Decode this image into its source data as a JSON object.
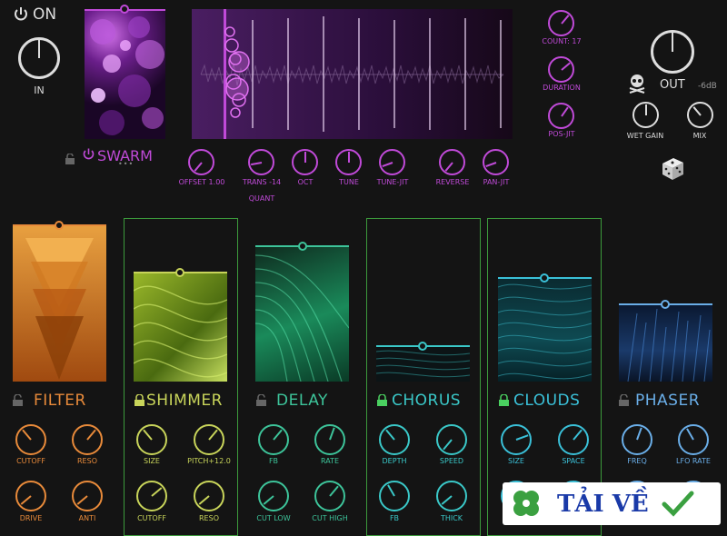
{
  "header": {
    "power_label": "ON",
    "in_label": "IN",
    "out_label": "OUT",
    "out_db": "-6dB",
    "wet_gain_label": "WET GAIN",
    "mix_label": "MIX"
  },
  "swarm": {
    "title": "SWARM",
    "dots": "•••"
  },
  "side_knobs": [
    "COUNT: 17",
    "DURATION",
    "POS-JIT"
  ],
  "bottom_knobs": [
    "OFFSET 1.00",
    "TRANS -14",
    "OCT",
    "TUNE",
    "TUNE-JIT",
    "REVERSE",
    "PAN-JIT"
  ],
  "quant_label": "QUANT",
  "modules": [
    {
      "name": "FILTER",
      "color": "#e88a3a",
      "locked": false,
      "knobs": [
        "CUTOFF",
        "RESO",
        "DRIVE",
        "ANTI"
      ]
    },
    {
      "name": "SHIMMER",
      "color": "#c8d45a",
      "locked": true,
      "knobs": [
        "SIZE",
        "PITCH+12.0",
        "CUTOFF",
        "RESO"
      ]
    },
    {
      "name": "DELAY",
      "color": "#3dc49a",
      "locked": false,
      "knobs": [
        "FB",
        "RATE",
        "CUT LOW",
        "CUT HIGH"
      ]
    },
    {
      "name": "CHORUS",
      "color": "#3ac8c8",
      "locked": true,
      "knobs": [
        "DEPTH",
        "SPEED",
        "FB",
        "THICK"
      ]
    },
    {
      "name": "CLOUDS",
      "color": "#3ac0d8",
      "locked": true,
      "knobs": [
        "SIZE",
        "SPACE",
        "",
        ""
      ]
    },
    {
      "name": "PHASER",
      "color": "#6aaee8",
      "locked": false,
      "knobs": [
        "FREQ",
        "LFO RATE",
        "",
        ""
      ]
    }
  ],
  "watermark": {
    "text": "TẢI VỀ"
  },
  "colors": {
    "purple": "#c04ad8",
    "green_border": "#3c9a3c",
    "bg": "#141414"
  }
}
